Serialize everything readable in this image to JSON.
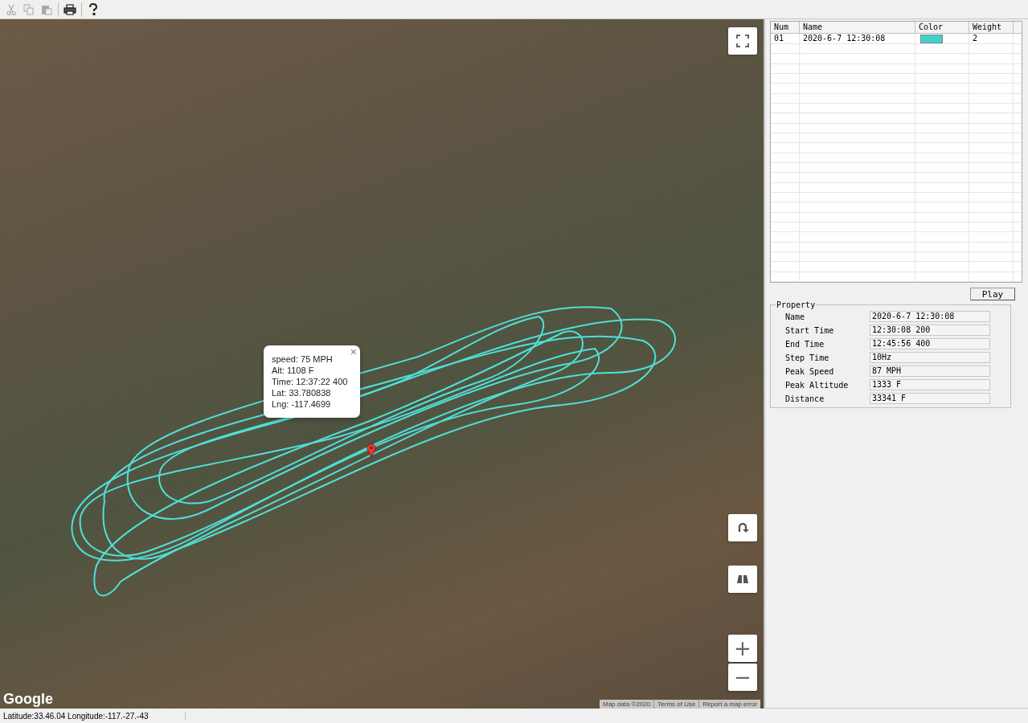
{
  "toolbar": {
    "buttons": [
      {
        "kind": "cut",
        "disabled": true
      },
      {
        "kind": "copy",
        "disabled": true
      },
      {
        "kind": "paste",
        "disabled": true
      },
      {
        "kind": "print",
        "disabled": false
      },
      {
        "kind": "help",
        "disabled": false
      }
    ]
  },
  "map": {
    "info_window": {
      "lines": [
        "speed: 75 MPH",
        "Alt: 1108 F",
        "Time: 12:37:22 400",
        "Lat: 33.780838",
        "Lng: -117.4699"
      ],
      "close": "×"
    },
    "zoom_in": "+",
    "zoom_out": "−",
    "logo": "Google",
    "attribution": [
      "Map data ©2020",
      "Terms of Use",
      "Report a map error"
    ]
  },
  "track_table": {
    "columns": [
      "Num",
      "Name",
      "Color",
      "Weight"
    ],
    "rows": [
      {
        "num": "01",
        "name": "2020-6-7 12:30:08",
        "color": "#3fd3cb",
        "weight": "2",
        "selected": false
      }
    ]
  },
  "play_button": "Play",
  "property": {
    "title": "Property",
    "fields": [
      {
        "label": "Name",
        "value": "2020-6-7 12:30:08"
      },
      {
        "label": "Start Time",
        "value": "12:30:08 200"
      },
      {
        "label": "End Time",
        "value": "12:45:56 400"
      },
      {
        "label": "Step Time",
        "value": "10Hz"
      },
      {
        "label": "Peak Speed",
        "value": "87 MPH"
      },
      {
        "label": "Peak Altitude",
        "value": "1333 F"
      },
      {
        "label": "Distance",
        "value": "33341 F"
      }
    ]
  },
  "status_bar": {
    "text": "Latitude:33.46.04 Longitude:-117.-27.-43"
  }
}
